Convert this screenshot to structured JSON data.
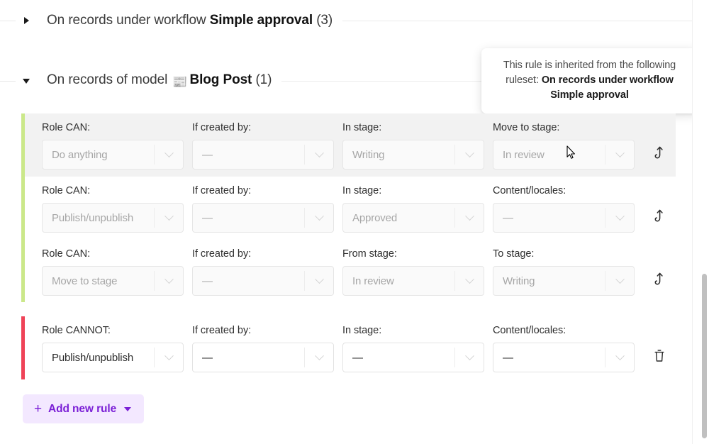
{
  "sections": [
    {
      "id": "workflow-section",
      "expanded": false,
      "caret": "caret-right-icon",
      "lead": "On records under workflow",
      "strong": "Simple approval",
      "count": "(3)",
      "model_icon": null
    },
    {
      "id": "model-section",
      "expanded": true,
      "caret": "caret-down-icon",
      "lead": "On records of model",
      "strong": "Blog Post",
      "count": "(1)",
      "model_icon": "📰"
    }
  ],
  "tooltip": {
    "name": "inherited-rule-tooltip",
    "line_prefix": "This rule is inherited from the following ruleset: ",
    "ruleset_name": "On records under workflow Simple approval"
  },
  "colors": {
    "accent_can": "#cbe88a",
    "accent_cannot": "#ef4358",
    "button_text": "#7b1fd6",
    "button_bg": "#f3e8ff"
  },
  "rule_groups": [
    {
      "name": "can-rules-group",
      "accent": "#cbe88a",
      "rows": [
        {
          "name": "rule-row-do-anything",
          "highlighted": true,
          "action_icon": "inherited-arrow-icon",
          "editable": false,
          "fields": [
            {
              "label": "Role CAN:",
              "value": "Do anything"
            },
            {
              "label": "If created by:",
              "value": "—"
            },
            {
              "label": "In stage:",
              "value": "Writing"
            },
            {
              "label": "Move to stage:",
              "value": "In review"
            }
          ]
        },
        {
          "name": "rule-row-publish-approved",
          "highlighted": false,
          "action_icon": "inherited-arrow-icon",
          "editable": false,
          "fields": [
            {
              "label": "Role CAN:",
              "value": "Publish/unpublish"
            },
            {
              "label": "If created by:",
              "value": "—"
            },
            {
              "label": "In stage:",
              "value": "Approved"
            },
            {
              "label": "Content/locales:",
              "value": "—"
            }
          ]
        },
        {
          "name": "rule-row-move-to-stage",
          "highlighted": false,
          "action_icon": "inherited-arrow-icon",
          "editable": false,
          "fields": [
            {
              "label": "Role CAN:",
              "value": "Move to stage"
            },
            {
              "label": "If created by:",
              "value": "—"
            },
            {
              "label": "From stage:",
              "value": "In review"
            },
            {
              "label": "To stage:",
              "value": "Writing"
            }
          ]
        }
      ]
    },
    {
      "name": "cannot-rules-group",
      "accent": "#ef4358",
      "rows": [
        {
          "name": "rule-row-cannot-publish",
          "highlighted": false,
          "action_icon": "trash-icon",
          "editable": true,
          "fields": [
            {
              "label": "Role CANNOT:",
              "value": "Publish/unpublish"
            },
            {
              "label": "If created by:",
              "value": "—"
            },
            {
              "label": "In stage:",
              "value": "—"
            },
            {
              "label": "Content/locales:",
              "value": "—"
            }
          ]
        }
      ]
    }
  ],
  "add_button": {
    "name": "add-new-rule-button",
    "plus": "+",
    "label": "Add new rule",
    "caret": "chevron-down-icon"
  }
}
